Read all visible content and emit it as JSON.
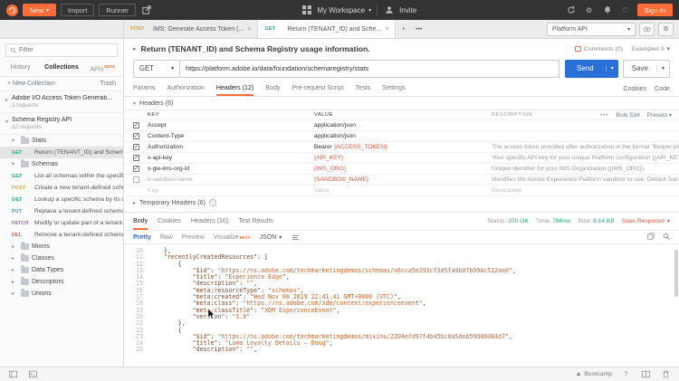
{
  "topbar": {
    "new": "New",
    "import": "Import",
    "runner": "Runner",
    "workspace": "My Workspace",
    "invite": "Invite",
    "signin": "Sign In"
  },
  "tabstrip": {
    "tabs": [
      {
        "method": "POST",
        "label": "IMS: Generate Access Token (...",
        "active": false
      },
      {
        "method": "GET",
        "label": "Return (TENANT_ID) and Sche...",
        "active": true
      }
    ],
    "new_tab": "+",
    "more": "•••",
    "environment": "Platform API"
  },
  "sidebar": {
    "filter_placeholder": "Filter",
    "tabs": [
      {
        "label": "History",
        "active": false
      },
      {
        "label": "Collections",
        "active": true
      },
      {
        "label": "APIs",
        "active": false,
        "beta": "BETA"
      }
    ],
    "new_collection": "+ New Collection",
    "trash": "Trash",
    "collections": [
      {
        "name": "Adobe I/O Access Token Generati...",
        "meta": "3 requests"
      },
      {
        "name": "Schema Registry API",
        "meta": "32 requests"
      }
    ],
    "tree": [
      {
        "type": "folder",
        "label": "Stats",
        "expanded": true
      },
      {
        "type": "request",
        "method": "GET",
        "label": "Return (TENANT_ID) and Schema ...",
        "selected": true
      },
      {
        "type": "folder",
        "label": "Schemas",
        "expanded": true
      },
      {
        "type": "request",
        "method": "GET",
        "label": "List all schemas within the specific..."
      },
      {
        "type": "request",
        "method": "POST",
        "label": "Create a new tenant-defined sche..."
      },
      {
        "type": "request",
        "method": "GET",
        "label": "Lookup a specific schema by its u..."
      },
      {
        "type": "request",
        "method": "PUT",
        "label": "Replace a tenant-defined schema..."
      },
      {
        "type": "request",
        "method": "PATCH",
        "label": "Modify or update part of a tenant-..."
      },
      {
        "type": "request",
        "method": "DEL",
        "label": "Remove a tenant-defined schema ..."
      },
      {
        "type": "folder",
        "label": "Mixins",
        "expanded": false
      },
      {
        "type": "folder",
        "label": "Classes",
        "expanded": false
      },
      {
        "type": "folder",
        "label": "Data Types",
        "expanded": false
      },
      {
        "type": "folder",
        "label": "Descriptors",
        "expanded": false
      },
      {
        "type": "folder",
        "label": "Unions",
        "expanded": false
      }
    ]
  },
  "request": {
    "title": "Return (TENANT_ID) and Schema Registry usage information.",
    "comments": "Comments (0)",
    "examples": "Examples 0",
    "method": "GET",
    "url": "https://platform.adobe.io/data/foundation/schemaregistry/stats",
    "send": "Send",
    "save": "Save",
    "tabs": [
      "Params",
      "Authorization",
      "Headers (12)",
      "Body",
      "Pre-request Script",
      "Tests",
      "Settings"
    ],
    "active_tab": "Headers (12)",
    "cookies": "Cookies",
    "code": "Code",
    "headers_title": "Headers (6)",
    "temp_headers_title": "Temporary Headers (6)",
    "table": {
      "columns": [
        "KEY",
        "VALUE",
        "DESCRIPTION"
      ],
      "more": "•••",
      "bulk_edit": "Bulk Edit",
      "presets": "Presets",
      "rows": [
        {
          "checked": true,
          "key": "Accept",
          "value": "application/json",
          "desc": ""
        },
        {
          "checked": true,
          "key": "Content-Type",
          "value": "application/json",
          "desc": ""
        },
        {
          "checked": true,
          "key": "Authorization",
          "value_prefix": "Bearer ",
          "value_var": "{ACCESS_TOKEN}",
          "desc": "The access token provided after authorization in the format \"Bearer {ACCESS..."
        },
        {
          "checked": true,
          "key": "x-api-key",
          "value_var": "{API_KEY}",
          "desc": "Your specific API key for your unique Platform configuration ({API_KEY})"
        },
        {
          "checked": true,
          "key": "x-gw-ims-org-id",
          "value_var": "{IMS_ORG}",
          "desc": "Unique identifier for your IMS Organization ({IMS_ORG})"
        },
        {
          "checked": false,
          "key": "x-sandbox-name",
          "value_var": "{SANDBOX_NAME}",
          "desc": "Identifies the Adobe Experience Platform sandbox to use. Default Sandbox is..."
        }
      ],
      "placeholder_row": {
        "key": "Key",
        "value": "Value",
        "desc": "Description"
      }
    }
  },
  "response": {
    "tabs": [
      "Body",
      "Cookies",
      "Headers (10)",
      "Test Results"
    ],
    "active_tab": "Body",
    "status_label": "Status:",
    "status": "200 OK",
    "time_label": "Time:",
    "time": "786ms",
    "size_label": "Size:",
    "size": "8.14 KB",
    "save_response": "Save Response",
    "view_tabs": [
      "Pretty",
      "Raw",
      "Preview",
      "Visualize"
    ],
    "active_view": "Pretty",
    "visualize_beta": "BETA",
    "format": "JSON",
    "code_lines": [
      {
        "n": 10,
        "t": "    },"
      },
      {
        "n": 11,
        "t": "    \"recentlyCreatedResources\": ["
      },
      {
        "n": 12,
        "t": "        {"
      },
      {
        "n": 13,
        "t": "            \"$id\": \"https://ns.adobe.com/techmarketingdemos/schemas/a6cca5e293cf3d5fa9b07b994c512ae0\","
      },
      {
        "n": 14,
        "t": "            \"title\": \"Experience Edge\","
      },
      {
        "n": 15,
        "t": "            \"description\": \"\","
      },
      {
        "n": 16,
        "t": "            \"meta:resourceType\": \"schemas\","
      },
      {
        "n": 17,
        "t": "            \"meta:created\": \"Wed Nov 06 2019 22:41:41 GMT+0000 (UTC)\","
      },
      {
        "n": 18,
        "t": "            \"meta:class\": \"https://ns.adobe.com/xdm/context/experienceevent\","
      },
      {
        "n": 19,
        "t": "            \"meta:classTitle\": \"XDM ExperienceEvent\","
      },
      {
        "n": 20,
        "t": "            \"version\": \"1.0\""
      },
      {
        "n": 21,
        "t": "        },"
      },
      {
        "n": 22,
        "t": "        {"
      },
      {
        "n": 23,
        "t": "            \"$id\": \"https://ns.adobe.com/techmarketingdemos/mixins/2204efd97f4b45bc0a5deb59d46084d7\","
      },
      {
        "n": 24,
        "t": "            \"title\": \"Luma Loyalty Details — Doug\","
      },
      {
        "n": 25,
        "t": "            \"description\": \"\","
      }
    ]
  },
  "statusbar": {
    "bootcamp": "Bootcamp"
  },
  "colors": {
    "accent": "#ff6c37",
    "send_button": "#2a6fd6",
    "status_ok": "#26a873",
    "variable": "#e8563f"
  }
}
